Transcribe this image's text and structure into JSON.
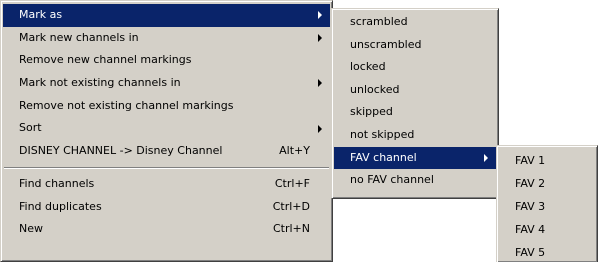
{
  "main_menu": {
    "items": [
      {
        "label": "Mark as",
        "shortcut": "",
        "submenu": true,
        "selected": true
      },
      {
        "label": "Mark new channels in",
        "shortcut": "",
        "submenu": true,
        "selected": false
      },
      {
        "label": "Remove new channel markings",
        "shortcut": "",
        "submenu": false,
        "selected": false
      },
      {
        "label": "Mark not existing channels in",
        "shortcut": "",
        "submenu": true,
        "selected": false
      },
      {
        "label": "Remove not existing channel markings",
        "shortcut": "",
        "submenu": false,
        "selected": false
      },
      {
        "label": "Sort",
        "shortcut": "",
        "submenu": true,
        "selected": false
      },
      {
        "label": "DISNEY CHANNEL -> Disney Channel",
        "shortcut": "Alt+Y",
        "submenu": false,
        "selected": false
      }
    ],
    "items2": [
      {
        "label": "Find channels",
        "shortcut": "Ctrl+F"
      },
      {
        "label": "Find duplicates",
        "shortcut": "Ctrl+D"
      },
      {
        "label": "New",
        "shortcut": "Ctrl+N"
      }
    ]
  },
  "mark_as_submenu": {
    "items": [
      {
        "label": "scrambled"
      },
      {
        "label": "unscrambled"
      },
      {
        "label": "locked"
      },
      {
        "label": "unlocked"
      },
      {
        "label": "skipped"
      },
      {
        "label": "not skipped"
      },
      {
        "label": "FAV channel",
        "submenu": true,
        "selected": true
      },
      {
        "label": "no FAV channel"
      }
    ]
  },
  "fav_submenu": {
    "items": [
      {
        "label": "FAV 1"
      },
      {
        "label": "FAV 2"
      },
      {
        "label": "FAV 3"
      },
      {
        "label": "FAV 4"
      },
      {
        "label": "FAV 5"
      }
    ]
  },
  "colors": {
    "menu_background": "#d4d0c8",
    "selection_background": "#0a246a",
    "selection_text": "#ffffff"
  },
  "icons": {
    "submenu_arrow": "chevron-right-icon"
  }
}
